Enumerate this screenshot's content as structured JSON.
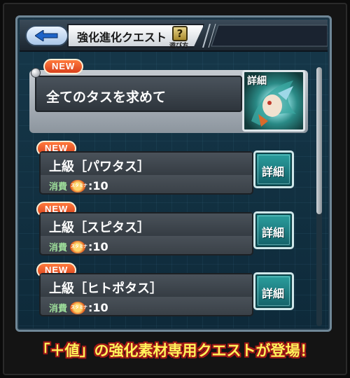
{
  "header": {
    "title": "強化進化クエスト",
    "help_icon_glyph": "?",
    "help_label": "遊び方"
  },
  "featured_quest": {
    "badge": "NEW",
    "name": "全てのタスを求めて",
    "detail_label": "詳細"
  },
  "quests": [
    {
      "badge": "NEW",
      "name": "上級［パワタス］",
      "cost_label": "消費",
      "stamina_label": "スタミナ",
      "cost_value": ":10",
      "detail_label": "詳細"
    },
    {
      "badge": "NEW",
      "name": "上級［スピタス］",
      "cost_label": "消費",
      "stamina_label": "スタミナ",
      "cost_value": ":10",
      "detail_label": "詳細"
    },
    {
      "badge": "NEW",
      "name": "上級［ヒトポタス］",
      "cost_label": "消費",
      "stamina_label": "スタミナ",
      "cost_value": ":10",
      "detail_label": "詳細"
    }
  ],
  "banner": {
    "text": "「＋値」の強化素材専用クエストが登場！"
  },
  "colors": {
    "new_badge": "#e0501f",
    "detail_button": "#1f8a8c",
    "banner_text": "#fff35a",
    "banner_outline": "#a01818",
    "panel_bg": "#16384a"
  }
}
